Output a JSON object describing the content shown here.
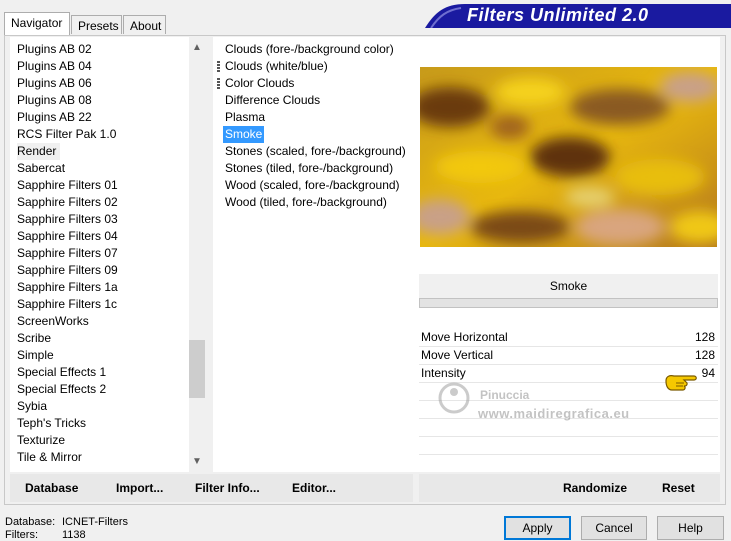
{
  "tabs": [
    "Navigator",
    "Presets",
    "About"
  ],
  "banner": "Filters Unlimited 2.0",
  "categories": [
    "Plugins AB 02",
    "Plugins AB 04",
    "Plugins AB 06",
    "Plugins AB 08",
    "Plugins AB 22",
    "RCS Filter Pak 1.0",
    "Render",
    "Sabercat",
    "Sapphire Filters 01",
    "Sapphire Filters 02",
    "Sapphire Filters 03",
    "Sapphire Filters 04",
    "Sapphire Filters 07",
    "Sapphire Filters 09",
    "Sapphire Filters 1a",
    "Sapphire Filters 1c",
    "ScreenWorks",
    "Scribe",
    "Simple",
    "Special Effects 1",
    "Special Effects 2",
    "Sybia",
    "Teph's Tricks",
    "Texturize",
    "Tile & Mirror"
  ],
  "selected_category": "Render",
  "filters": [
    "Clouds (fore-/background color)",
    "Clouds (white/blue)",
    "Color Clouds",
    "Difference Clouds",
    "Plasma",
    "Smoke",
    "Stones (scaled, fore-/background)",
    "Stones (tiled, fore-/background)",
    "Wood (scaled, fore-/background)",
    "Wood (tiled, fore-/background)"
  ],
  "selected_filter": "Smoke",
  "filter_name": "Smoke",
  "params": [
    {
      "label": "Move Horizontal",
      "value": "128"
    },
    {
      "label": "Move Vertical",
      "value": "128"
    },
    {
      "label": "Intensity",
      "value": "94"
    }
  ],
  "left_buttons": {
    "database": "Database",
    "import": "Import...",
    "filter_info": "Filter Info...",
    "editor": "Editor..."
  },
  "right_buttons": {
    "randomize": "Randomize",
    "reset": "Reset"
  },
  "status": {
    "database_label": "Database:",
    "database_value": "ICNET-Filters",
    "filters_label": "Filters:",
    "filters_value": "1138"
  },
  "dialog_buttons": {
    "apply": "Apply",
    "cancel": "Cancel",
    "help": "Help"
  },
  "watermark": {
    "name": "Pinuccia",
    "site": "www.maidiregrafica.eu"
  },
  "colors": {
    "banner_bg": "#1a1aa0",
    "selection": "#3399ff",
    "apply_border": "#0078d7"
  }
}
